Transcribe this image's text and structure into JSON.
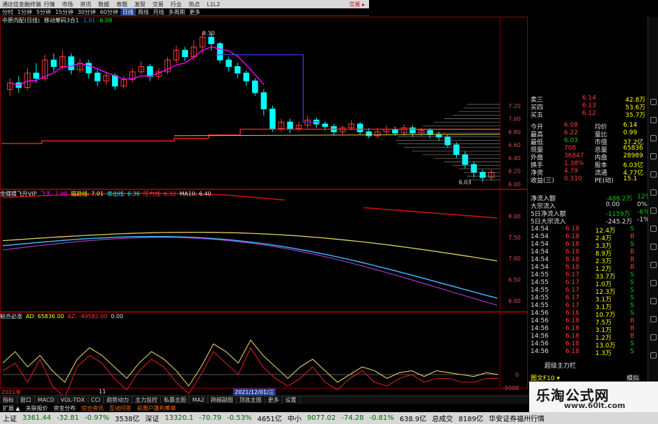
{
  "window": {
    "title": "通达信金融终端",
    "menu": [
      "行情",
      "市场",
      "资讯",
      "数据",
      "寿题",
      "发现",
      "交易",
      "行业",
      "热点",
      "L1L2"
    ],
    "trade_label": "交易 ▸"
  },
  "toolbar": [
    "分时",
    "1分钟",
    "5分钟",
    "15分钟",
    "30分钟",
    "60分钟",
    "日线",
    "周线",
    "月线",
    "多周期",
    "更多"
  ],
  "toolbar_selected": 6,
  "info": {
    "stock": "中原内配(日线)",
    "ind1": "移动筹码3合1",
    "v1": "1.01",
    "v2": "6.09",
    "price_high": "8.30",
    "price_low": "6.03"
  },
  "panel2": {
    "name": "金蝶蝶飞升VIP",
    "items": [
      "飞天: 7.98",
      "猫趋线: 7.01",
      "卖出线: 6.36",
      "压力线: 6.32",
      "MA10: 6.40"
    ]
  },
  "panel3": {
    "name": "粘合必涨",
    "items": [
      "AD: 65836.00",
      "AZ: -49582.00",
      "0.00"
    ]
  },
  "dates": {
    "left": "2021年",
    "mid": "11",
    "sel": "2021/12/01/三"
  },
  "tabs": [
    "指标",
    "窗口",
    "MACD",
    "VOL-TDX",
    "CCI",
    "趋势动力",
    "主力监控",
    "私募主图",
    "MA2",
    "跨越副图",
    "顶底主图",
    "更多",
    "设置"
  ],
  "tabs_selected": -1,
  "footer": [
    "扩展 ▲",
    "关联报价",
    "资金分布",
    "综合资讯",
    "互动问答",
    "前周户篷利筹章"
  ],
  "status": {
    "sh_name": "上证",
    "sh_val": "3361.44",
    "sh_chg": "-32.81",
    "sh_pct": "-0.97%",
    "sh_amt": "3538亿",
    "sz_name": "深证",
    "sz_val": "13320.1",
    "sz_chg": "-70.79",
    "sz_pct": "-0.53%",
    "sz_amt": "4651亿",
    "zx_name": "中小",
    "zx_val": "9077.02",
    "zx_chg": "-74.28",
    "zx_pct": "-0.81%",
    "zx_amt": "638.9亿",
    "total_label": "总成交",
    "total_val": "8189亿",
    "broker": "华安证券福州行情"
  },
  "quote": {
    "asks": [
      {
        "label": "卖三",
        "price": "6.14",
        "vol": "42.8万"
      },
      {
        "label": "买四",
        "price": "6.13",
        "vol": "53.6万"
      },
      {
        "label": "买五",
        "price": "6.12",
        "vol": "35.7万"
      }
    ],
    "stats": [
      {
        "l1": "今开",
        "v1": "6.08",
        "l2": "均价",
        "v2": "6.14"
      },
      {
        "l1": "最高",
        "v1": "6.22",
        "l2": "量比",
        "v2": "0.99"
      },
      {
        "l1": "最低",
        "v1": "6.03",
        "l2": "市值",
        "v2": "37.2亿"
      },
      {
        "l1": "现量",
        "v1": "708",
        "l2": "总量",
        "v2": "65836"
      },
      {
        "l1": "外盘",
        "v1": "36847",
        "l2": "内盘",
        "v2": "28989"
      },
      {
        "l1": "换手",
        "v1": "1.38%",
        "l2": "股本",
        "v2": "6.03亿"
      },
      {
        "l1": "净资",
        "v1": "4.79",
        "l2": "流通",
        "v2": "4.77亿"
      },
      {
        "l1": "收益(三)",
        "v1": "0.310",
        "l2": "PE(动)",
        "v2": "15.1"
      }
    ],
    "flows": [
      {
        "label": "净流入额",
        "val": "-488.2万",
        "pct": "12%"
      },
      {
        "label": "大宗流入",
        "val": "0.00",
        "pct": "0%"
      },
      {
        "label": "5日净流入额",
        "val": "-1159万",
        "pct": "-6%"
      },
      {
        "label": "5日大宗流入",
        "val": "-245.2万",
        "pct": "-1%"
      }
    ],
    "ticks": [
      {
        "t": "14:54",
        "p": "6.18",
        "v": "12.4万",
        "d": "S"
      },
      {
        "t": "14:54",
        "p": "6.18",
        "v": "2.4万",
        "d": "B"
      },
      {
        "t": "14:54",
        "p": "6.18",
        "v": "3.3万",
        "d": "S"
      },
      {
        "t": "14:54",
        "p": "6.18",
        "v": "8.9万",
        "d": "B"
      },
      {
        "t": "14:54",
        "p": "6.18",
        "v": "2.3万",
        "d": "B"
      },
      {
        "t": "14:54",
        "p": "6.18",
        "v": "1.2万",
        "d": "B"
      },
      {
        "t": "14:55",
        "p": "6.17",
        "v": "33.7万",
        "d": "S"
      },
      {
        "t": "14:55",
        "p": "6.17",
        "v": "1.0万",
        "d": "S"
      },
      {
        "t": "14:55",
        "p": "6.17",
        "v": "12.3万",
        "d": "S"
      },
      {
        "t": "14:55",
        "p": "6.17",
        "v": "3.1万",
        "d": "S"
      },
      {
        "t": "14:55",
        "p": "6.17",
        "v": "3.1万",
        "d": "S"
      },
      {
        "t": "14:56",
        "p": "6.16",
        "v": "10.7万",
        "d": "S"
      },
      {
        "t": "14:56",
        "p": "6.18",
        "v": "7.5万",
        "d": "B"
      },
      {
        "t": "14:56",
        "p": "6.18",
        "v": "3.1万",
        "d": "B"
      },
      {
        "t": "14:56",
        "p": "6.18",
        "v": "1.2万",
        "d": "B"
      },
      {
        "t": "14:56",
        "p": "6.18",
        "v": "13.0万",
        "d": "S"
      },
      {
        "t": "14:56",
        "p": "6.18",
        "v": "1.3万",
        "d": "S"
      }
    ],
    "tick_label": "超级主力栏",
    "fs_label": "图文F10 ▾",
    "mode_label": "模拟"
  },
  "axis_main": [
    "7.20",
    "7.00",
    "6.80",
    "6.60",
    "6.40",
    "6.20",
    "6.00"
  ],
  "axis_p2": [
    "8.00",
    "7.50",
    "7.00",
    "6.50",
    "6.00"
  ],
  "axis_p3": [
    "0",
    "-5000"
  ],
  "watermark": {
    "title": "乐淘公式网",
    "url": "www.60lt.com"
  },
  "colors": {
    "up": "#ff3c3c",
    "down": "#00ffff",
    "frame": "#8b0000"
  }
}
